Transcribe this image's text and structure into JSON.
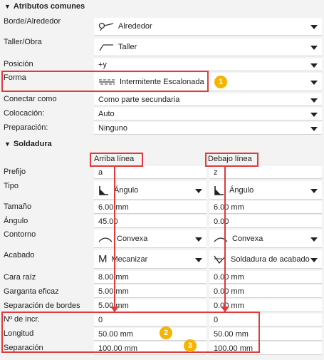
{
  "common": {
    "title": "Atributos comunes",
    "rows": {
      "borde": {
        "label": "Borde/Alrededor",
        "value": "Alrededor",
        "icon": "weld-all-around-icon"
      },
      "taller": {
        "label": "Taller/Obra",
        "value": "Taller",
        "icon": "shop-weld-icon"
      },
      "posicion": {
        "label": "Posición",
        "value": "+y"
      },
      "forma": {
        "label": "Forma",
        "value": "Intermitente Escalonada",
        "icon": "staggered-intermittent-icon"
      },
      "conectar": {
        "label": "Conectar como",
        "value": "Como parte secundaria"
      },
      "colocacion": {
        "label": "Colocación:",
        "value": "Auto"
      },
      "preparacion": {
        "label": "Preparación:",
        "value": "Ninguno"
      }
    }
  },
  "weld": {
    "title": "Soldadura",
    "above_header": "Arriba línea",
    "below_header": "Debajo línea",
    "rows": {
      "prefijo": {
        "label": "Prefijo",
        "above": "a",
        "below": "z"
      },
      "tipo": {
        "label": "Tipo",
        "above": "Ángulo",
        "below": "Ángulo",
        "icon": "fillet-weld-icon"
      },
      "tamano": {
        "label": "Tamaño",
        "above": "6.00",
        "below": "6.00",
        "unit": "mm"
      },
      "angulo": {
        "label": "Ángulo",
        "above": "45.00",
        "below": "0.00"
      },
      "contorno": {
        "label": "Contorno",
        "above": "Convexa",
        "below": "Convexa",
        "icon": "convex-contour-icon"
      },
      "acabado": {
        "label": "Acabado",
        "above": "Mecanizar",
        "below": "Soldadura de acabado",
        "above_icon": "M",
        "below_icon": "finish-weld-icon"
      },
      "cara_raiz": {
        "label": "Cara raíz",
        "above": "8.00",
        "below": "0.00",
        "unit": "mm"
      },
      "garganta": {
        "label": "Garganta eficaz",
        "above": "5.00",
        "below": "0.00",
        "unit": "mm"
      },
      "separacion_bordes": {
        "label": "Separación de bordes",
        "above": "5.00",
        "below": "0.00",
        "unit": "mm"
      },
      "n_incr": {
        "label": "Nº de incr.",
        "above": "0",
        "below": "0"
      },
      "longitud": {
        "label": "Longitud",
        "above": "50.00 mm",
        "below": "50.00 mm"
      },
      "separacion": {
        "label": "Separación",
        "above": "100.00 mm",
        "below": "100.00 mm"
      }
    }
  },
  "badges": [
    "1",
    "2",
    "3"
  ],
  "colors": {
    "highlight": "#e03a3a",
    "badge": "#f5b400"
  }
}
